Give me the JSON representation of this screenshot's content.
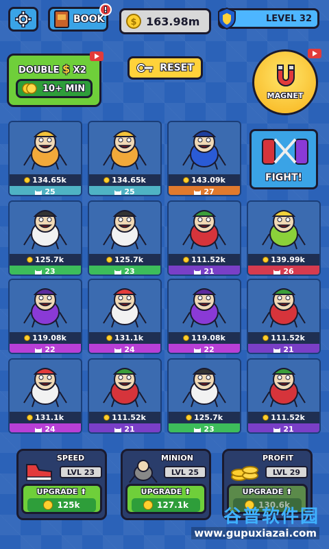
{
  "topbar": {
    "book_label": "BOOK",
    "book_badge": "!",
    "money": "163.98m",
    "level": "LEVEL 32"
  },
  "double": {
    "title": "DOUBLE",
    "multiplier": "X2",
    "duration": "10+ MIN"
  },
  "reset_label": "RESET",
  "magnet_label": "MAGNET",
  "fight_label": "FIGHT!",
  "colors": {
    "teal": "#4fb3c4",
    "orange": "#e07a2e",
    "green": "#3dbd5b",
    "purple": "#7a3fc7",
    "magenta": "#b83fd6",
    "red": "#d63b4f"
  },
  "cards": [
    {
      "income": "134.65k",
      "level": "25",
      "color": "#4fb3c4",
      "monster": "miner-monster-icon"
    },
    {
      "income": "134.65k",
      "level": "25",
      "color": "#4fb3c4",
      "monster": "miner-monster-icon"
    },
    {
      "income": "143.09k",
      "level": "27",
      "color": "#e07a2e",
      "monster": "captain-monster-icon"
    },
    {
      "income": "",
      "level": "",
      "color": "",
      "monster": "fight-icon"
    },
    {
      "income": "125.7k",
      "level": "23",
      "color": "#3dbd5b",
      "monster": "butcher-monster-icon"
    },
    {
      "income": "125.7k",
      "level": "23",
      "color": "#3dbd5b",
      "monster": "butcher-monster-icon"
    },
    {
      "income": "111.52k",
      "level": "21",
      "color": "#7a3fc7",
      "monster": "tomato-monster-icon"
    },
    {
      "income": "139.99k",
      "level": "26",
      "color": "#d63b4f",
      "monster": "cool-monster-icon"
    },
    {
      "income": "119.08k",
      "level": "22",
      "color": "#b83fd6",
      "monster": "witch-monster-icon"
    },
    {
      "income": "131.1k",
      "level": "24",
      "color": "#b83fd6",
      "monster": "nurse-monster-icon"
    },
    {
      "income": "119.08k",
      "level": "22",
      "color": "#b83fd6",
      "monster": "witch-monster-icon"
    },
    {
      "income": "111.52k",
      "level": "21",
      "color": "#7a3fc7",
      "monster": "tomato-monster-icon"
    },
    {
      "income": "131.1k",
      "level": "24",
      "color": "#b83fd6",
      "monster": "nurse-monster-icon"
    },
    {
      "income": "111.52k",
      "level": "21",
      "color": "#7a3fc7",
      "monster": "tomato-monster-icon"
    },
    {
      "income": "125.7k",
      "level": "23",
      "color": "#3dbd5b",
      "monster": "butcher-monster-icon"
    },
    {
      "income": "111.52k",
      "level": "21",
      "color": "#7a3fc7",
      "monster": "tomato-monster-icon"
    }
  ],
  "upgrades": [
    {
      "title": "SPEED",
      "level": "LVL 23",
      "button": "UPGRADE",
      "cost": "125k",
      "icon": "sneaker-icon"
    },
    {
      "title": "MINION",
      "level": "LVL 25",
      "button": "UPGRADE",
      "cost": "127.1k",
      "icon": "minion-icon"
    },
    {
      "title": "PROFIT",
      "level": "LVL 29",
      "button": "UPGRADE",
      "cost": "130.6k",
      "icon": "coins-icon"
    }
  ],
  "watermark": {
    "title": "谷普软件园",
    "url": "www.gupuxiazai.com"
  }
}
